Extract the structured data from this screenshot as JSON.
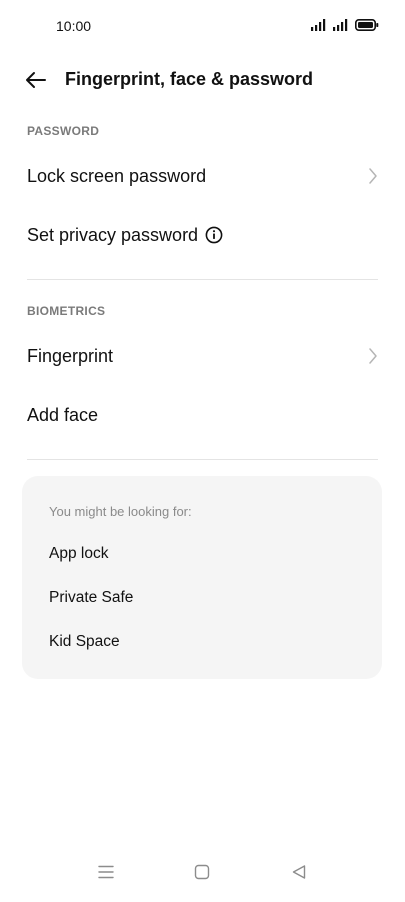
{
  "status_bar": {
    "time": "10:00",
    "icons": [
      "signal-icon",
      "signal-icon",
      "battery-icon"
    ]
  },
  "app_bar": {
    "title": "Fingerprint, face & password",
    "back_icon": "arrow-left-icon"
  },
  "sections": {
    "password": {
      "header": "PASSWORD",
      "items": [
        {
          "label": "Lock screen password",
          "icon": "chevron-right-icon"
        },
        {
          "label": "Set privacy password",
          "icon": "info-icon"
        }
      ]
    },
    "biometrics": {
      "header": "BIOMETRICS",
      "items": [
        {
          "label": "Fingerprint",
          "icon": "chevron-right-icon"
        },
        {
          "label": "Add face"
        }
      ]
    }
  },
  "suggestions": {
    "title": "You might be looking for:",
    "items": [
      "App lock",
      "Private Safe",
      "Kid Space"
    ]
  },
  "nav_bar": {
    "icons": [
      "menu-icon",
      "home-icon",
      "back-triangle-icon"
    ]
  },
  "colors": {
    "background": "#ffffff",
    "card": "#f5f5f5",
    "header_text": "#7a7a7a",
    "divider": "#e4e4e4"
  }
}
